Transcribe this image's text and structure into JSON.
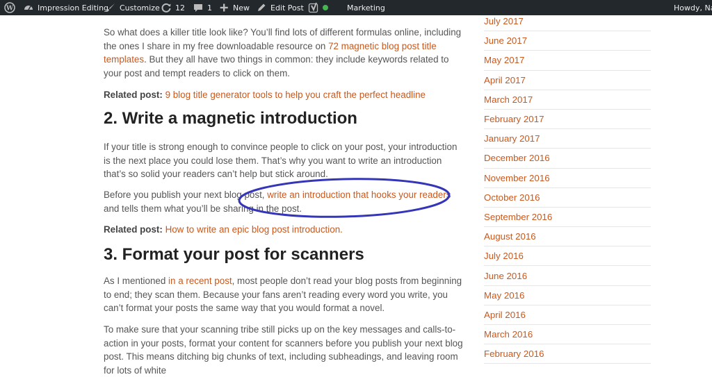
{
  "adminbar": {
    "site_name": "Impression Editing",
    "customize": "Customize",
    "updates_count": "12",
    "comments_count": "1",
    "new_label": "New",
    "edit_post": "Edit Post",
    "seo_status_color": "#46b450",
    "category": "Marketing",
    "greeting": "Howdy, Nac"
  },
  "article": {
    "p1_before": "So what does a killer title look like? You’ll find lots of different formulas online, including the ones I share in my free downloadable resource on ",
    "p1_link": "72 magnetic blog post title templates",
    "p1_after": ". But they all have two things in common: they include keywords related to your post and tempt readers to click on them.",
    "related1_label": "Related post:",
    "related1_link": "9 blog title generator tools to help you craft the perfect headline",
    "h2_intro": "2. Write a magnetic introduction",
    "p2": "If your title is strong enough to convince people to click on your post, your introduction is the next place you could lose them. That’s why you want to write an introduction that’s so solid your readers can’t help but stick around.",
    "p3_before": "Before you publish your next blog post, ",
    "p3_link": "write an introduction that hooks your readers",
    "p3_after": " and tells them what you’ll be sharing in the post.",
    "related2_label": "Related post:",
    "related2_link": "How to write an epic blog post introduction.",
    "h2_format": "3. Format your post for scanners",
    "p4_before": "As I mentioned ",
    "p4_link": "in a recent post",
    "p4_after": ", most people don’t read your blog posts from beginning to end; they scan them. Because your fans aren’t reading every word you write, you can’t format your posts the same way that you would format a novel.",
    "p5": "To make sure that your scanning tribe still picks up on the key messages and calls-to-action in your posts, format your content for scanners before you publish your next blog post. This means ditching big chunks of text, including subheadings, and leaving room for lots of white"
  },
  "sidebar": {
    "archives": [
      "July 2017",
      "June 2017",
      "May 2017",
      "April 2017",
      "March 2017",
      "February 2017",
      "January 2017",
      "December 2016",
      "November 2016",
      "October 2016",
      "September 2016",
      "August 2016",
      "July 2016",
      "June 2016",
      "May 2016",
      "April 2016",
      "March 2016",
      "February 2016"
    ]
  },
  "colors": {
    "adminbar_bg": "#23282d",
    "link": "#c9581c",
    "annotation_ellipse": "#3535b8"
  }
}
